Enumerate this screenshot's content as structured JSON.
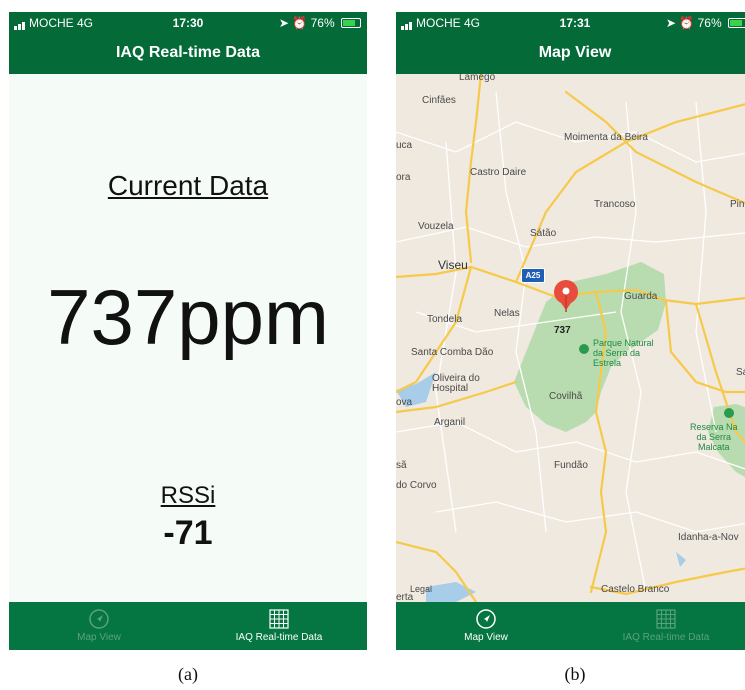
{
  "panel_a": {
    "status": {
      "carrier": "MOCHE  4G",
      "time": "17:30",
      "battery": "76%"
    },
    "nav_title": "IAQ Real-time Data",
    "heading": "Current Data",
    "reading": "737ppm",
    "rssi_label": "RSSi",
    "rssi_value": "-71",
    "tabs": [
      {
        "label": "Map View",
        "icon": "compass-icon",
        "active": false
      },
      {
        "label": "IAQ Real-time Data",
        "icon": "grid-icon",
        "active": true
      }
    ]
  },
  "panel_b": {
    "status": {
      "carrier": "MOCHE  4G",
      "time": "17:31",
      "battery": "76%"
    },
    "nav_title": "Map View",
    "route_badge": "A25",
    "pin_label": "737",
    "places": {
      "lamego": "Lamego",
      "cinfaes": "Cinfães",
      "moimenta": "Moimenta da Beira",
      "uca": "uca",
      "castro_daire": "Castro Daire",
      "ora": "ora",
      "trancoso": "Trancoso",
      "pin": "Pin",
      "vouzela": "Vouzela",
      "satao": "Sátão",
      "viseu": "Viseu",
      "guarda": "Guarda",
      "nelas": "Nelas",
      "tondela": "Tondela",
      "santa_comba": "Santa Comba Dão",
      "sabu": "Sabu",
      "oliveira": "Oliveira do\nHospital",
      "ova": "ova",
      "covilha": "Covilhã",
      "arganil": "Arganil",
      "sa": "sã",
      "fundao": "Fundão",
      "do_corvo": "do Corvo",
      "idanha": "Idanha-a-Nov",
      "castelo_branco": "Castelo Branco",
      "erta": "erta",
      "legal": "Legal"
    },
    "park_estrela": "Parque Natural\nda Serra da\nEstrela",
    "park_malcata": "Reserva Na\nda Serra\nMalcata",
    "tabs": [
      {
        "label": "Map View",
        "icon": "compass-icon",
        "active": true
      },
      {
        "label": "IAQ Real-time Data",
        "icon": "grid-icon",
        "active": false
      }
    ]
  },
  "captions": {
    "a": "(a)",
    "b": "(b)"
  },
  "colors": {
    "bar_green": "#046a38",
    "tab_green": "#057542",
    "map_bg": "#efe9df",
    "park": "#b8dcb0",
    "road": "#f7c94a",
    "pin": "#e84c3d"
  }
}
